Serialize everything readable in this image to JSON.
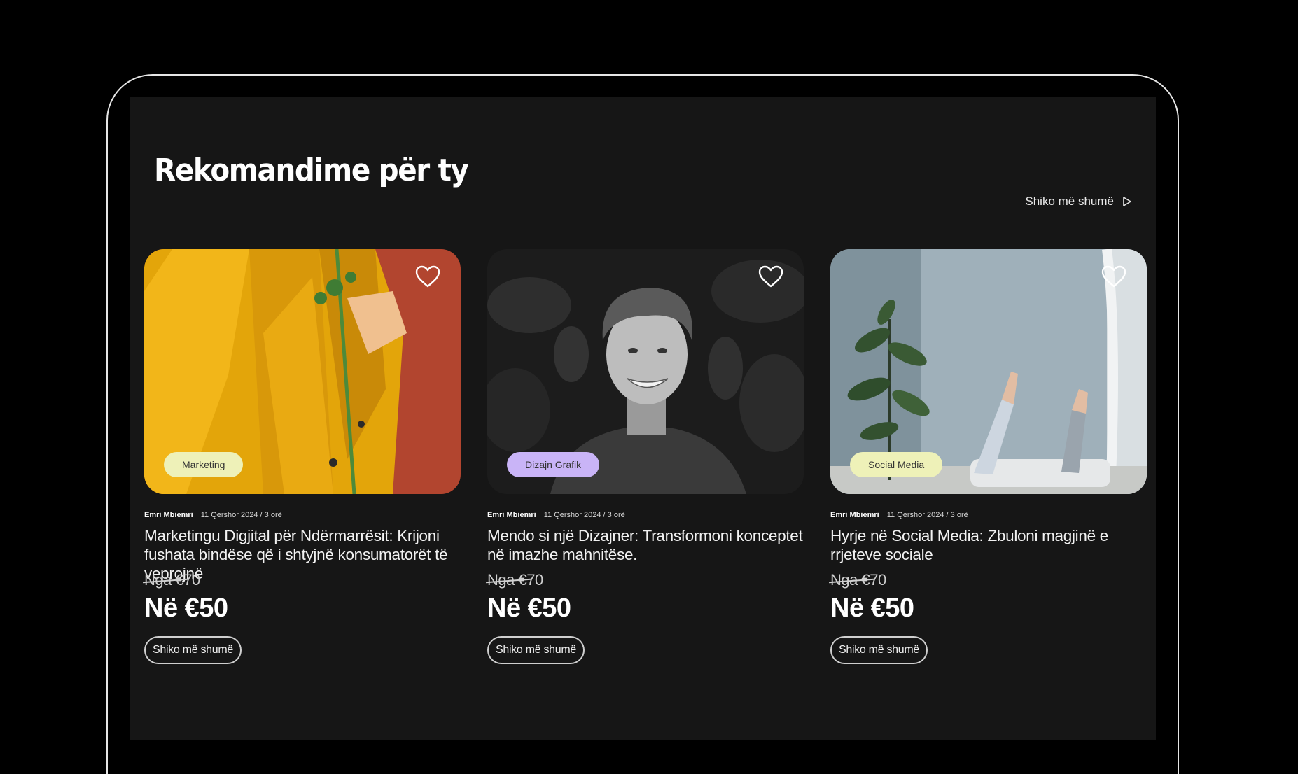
{
  "section": {
    "title": "Rekomandime për ty",
    "see_more": "Shiko më shumë"
  },
  "cards": [
    {
      "category": "Marketing",
      "category_color": "#eef1b8",
      "author": "Emri Mbiemri",
      "date": "11 Qershor 2024 / 3 orë",
      "title": "Marketingu Digjital për Ndërmarrësit: Krijoni fushata bindëse që i shtyjnë konsumatorët të veprojnë",
      "old_price": "Nga €70",
      "new_price": "Në €50",
      "button": "Shiko më shumë"
    },
    {
      "category": "Dizajn Grafik",
      "category_color": "#c9b4f7",
      "author": "Emri Mbiemri",
      "date": "11 Qershor 2024 / 3 orë",
      "title": "Mendo si një Dizajner: Transformoni konceptet në imazhe mahnitëse.",
      "old_price": "Nga €70",
      "new_price": "Në €50",
      "button": "Shiko më shumë"
    },
    {
      "category": "Social Media",
      "category_color": "#eef1b8",
      "author": "Emri Mbiemri",
      "date": "11 Qershor 2024 / 3 orë",
      "title": "Hyrje në Social Media: Zbuloni magjinë e rrjeteve sociale",
      "old_price": "Nga €70",
      "new_price": "Në €50",
      "button": "Shiko më shumë"
    }
  ]
}
